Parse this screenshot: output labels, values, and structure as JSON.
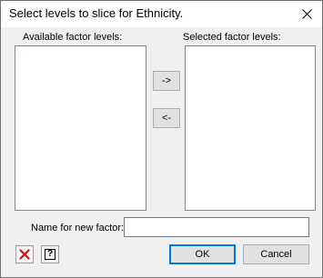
{
  "window": {
    "title": "Select levels to slice for Ethnicity."
  },
  "available": {
    "label": "Available factor levels:",
    "items": []
  },
  "selected": {
    "label": "Selected factor levels:",
    "items": []
  },
  "transfer": {
    "add_label": "->",
    "remove_label": "<-"
  },
  "new_factor": {
    "label": "Name for new factor:",
    "value": ""
  },
  "footer": {
    "clear_icon": "red-x-icon",
    "help_icon": "help-question-icon",
    "help_glyph": "?",
    "ok_label": "OK",
    "cancel_label": "Cancel"
  },
  "colors": {
    "clear_icon_color": "#c4151c",
    "default_button_border": "#0078d7"
  }
}
